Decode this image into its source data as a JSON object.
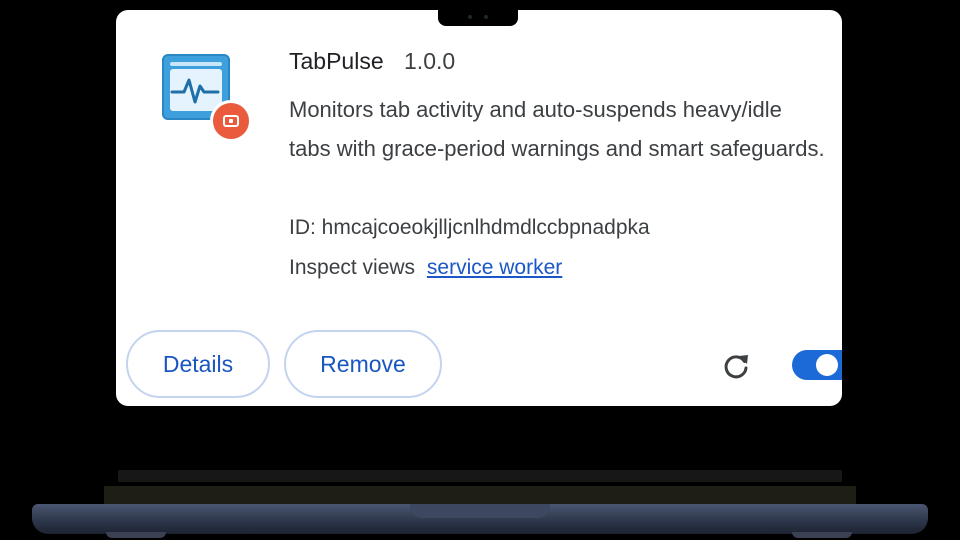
{
  "extension": {
    "name": "TabPulse",
    "version": "1.0.0",
    "description": "Monitors tab activity and auto-suspends heavy/idle tabs with grace-period warnings and smart safeguards.",
    "id_label": "ID: hmcajcoeokjlljcnlhdmdlccbpnadpka",
    "inspect_label": "Inspect views",
    "inspect_link": "service worker",
    "enabled": true
  },
  "buttons": {
    "details": "Details",
    "remove": "Remove"
  },
  "icons": {
    "extension_icon": "pulse-window-icon",
    "badge": "suspend-badge-icon",
    "reload": "reload-icon"
  },
  "colors": {
    "accent": "#1a56c0",
    "toggle_on": "#1b6ad8",
    "icon_blue": "#3d9fdc",
    "badge_red": "#ea5a3c"
  }
}
